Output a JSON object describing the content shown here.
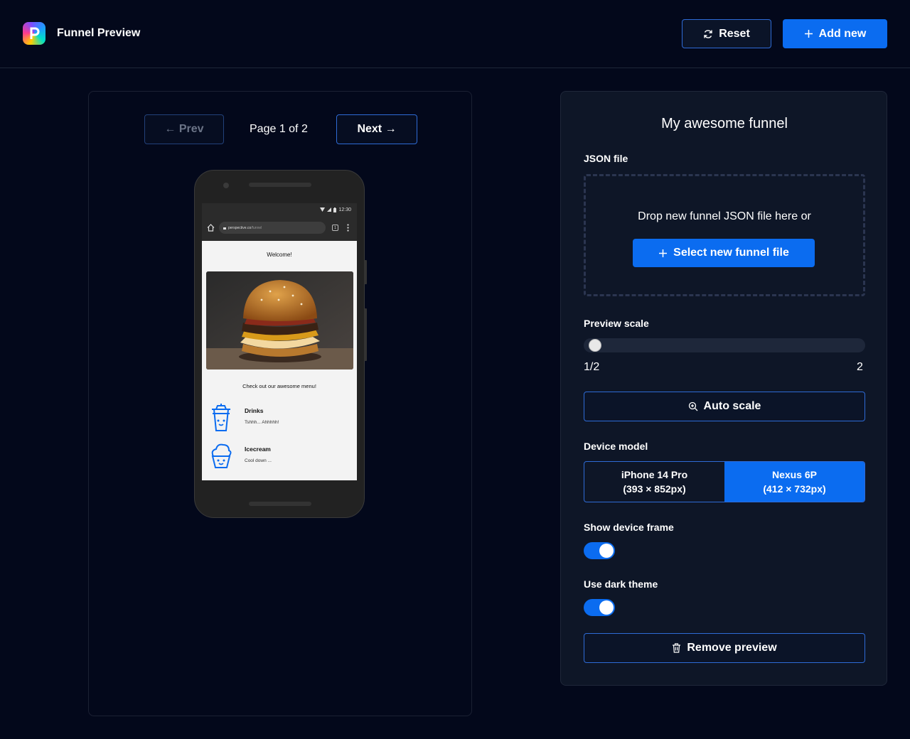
{
  "header": {
    "app_title": "Funnel Preview",
    "logo_icon": "perspective-logo-icon",
    "reset_label": "Reset",
    "add_new_label": "Add new",
    "accent_color": "#0b6cf0"
  },
  "pager": {
    "prev_label": "← Prev",
    "next_label": "Next →",
    "page_indicator": "Page 1 of 2"
  },
  "phone": {
    "status_time": "12:30",
    "url_domain": "perspective.co",
    "url_path": "/funnel",
    "tab_count": "1",
    "welcome_text": "Welcome!",
    "menu_intro": "Check out our awesome menu!",
    "menu_items": [
      {
        "name": "Drinks",
        "description": "Tshhh... Ahhhhh!",
        "icon": "drink-cup-icon"
      },
      {
        "name": "Icecream",
        "description": "Cool down ...",
        "icon": "icecream-icon"
      }
    ]
  },
  "settings": {
    "funnel_title": "My awesome funnel",
    "json_file_label": "JSON file",
    "drop_text": "Drop new funnel JSON file here or",
    "select_file_label": "Select new funnel file",
    "preview_scale_label": "Preview scale",
    "scale_min": "1/2",
    "scale_max": "2",
    "scale_value_fraction": 0.0,
    "auto_scale_label": "Auto scale",
    "device_model_label": "Device model",
    "devices": [
      {
        "name": "iPhone 14 Pro",
        "dims": "(393 × 852px)",
        "selected": false
      },
      {
        "name": "Nexus 6P",
        "dims": "(412 × 732px)",
        "selected": true
      }
    ],
    "show_frame_label": "Show device frame",
    "show_frame_on": true,
    "dark_theme_label": "Use dark theme",
    "dark_theme_on": true,
    "remove_preview_label": "Remove preview"
  }
}
